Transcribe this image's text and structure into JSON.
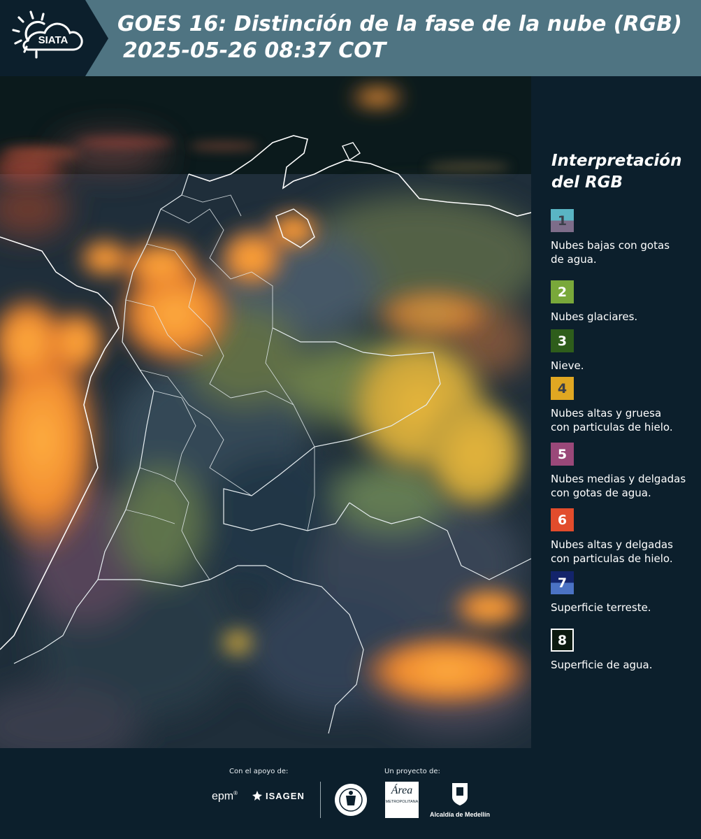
{
  "header": {
    "logo_text": "SIATA",
    "title_line1": "GOES 16: Distinción de la fase de la nube (RGB)",
    "title_line2": "2025-05-26 08:37 COT"
  },
  "legend": {
    "title_line1": "Interpretación",
    "title_line2": "del RGB",
    "items": [
      {
        "number": "1",
        "colors": [
          "#5ab5c4",
          "#7d6d8a"
        ],
        "text_line1": "Nubes bajas con gotas",
        "text_line2": "de agua.",
        "number_color": "#3b3f4a"
      },
      {
        "number": "2",
        "colors": [
          "#79a83a"
        ],
        "text_line1": "Nubes glaciares.",
        "text_line2": "",
        "number_color": "#ffffff"
      },
      {
        "number": "3",
        "colors": [
          "#2e5d1b"
        ],
        "text_line1": "Nieve.",
        "text_line2": "",
        "number_color": "#ffffff"
      },
      {
        "number": "4",
        "colors": [
          "#e0a722"
        ],
        "text_line1": "Nubes altas y gruesa",
        "text_line2": "con particulas de hielo.",
        "number_color": "#3b3f4a"
      },
      {
        "number": "5",
        "colors": [
          "#9a4879"
        ],
        "text_line1": "Nubes medias y delgadas",
        "text_line2": "con gotas de agua.",
        "number_color": "#ffffff"
      },
      {
        "number": "6",
        "colors": [
          "#e24c2c"
        ],
        "text_line1": "Nubes altas y delgadas",
        "text_line2": "con particulas de hielo.",
        "number_color": "#ffffff"
      },
      {
        "number": "7",
        "colors": [
          "#13246b",
          "#4b72c4"
        ],
        "text_line1": "Superficie terreste.",
        "text_line2": "",
        "number_color": "#ffffff"
      },
      {
        "number": "8",
        "colors": [
          "#0c1a10"
        ],
        "text_line1": "Superficie de agua.",
        "text_line2": "",
        "number_color": "#ffffff",
        "border": "#ffffff"
      }
    ]
  },
  "footer": {
    "support_label": "Con el apoyo de:",
    "project_label": "Un proyecto de:",
    "sponsor_1": "epm",
    "sponsor_2": "ISAGEN",
    "partner_1": "Área Metropolitana Valle de Aburrá",
    "partner_1_caption": "METROPOLITANA",
    "partner_2": "Alcaldía de Medellín"
  }
}
